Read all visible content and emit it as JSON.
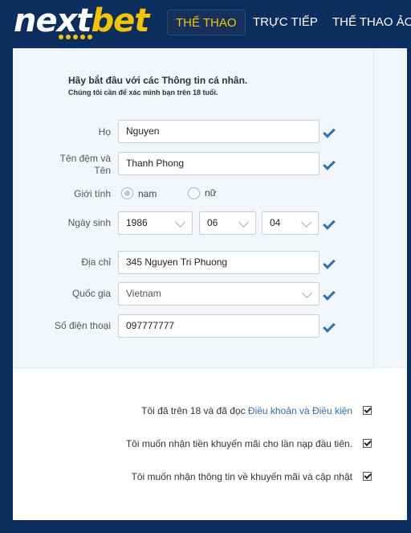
{
  "brand": {
    "name_part1": "next",
    "name_part2": "bet"
  },
  "nav": {
    "items": [
      {
        "label": "Thể thao",
        "active": true
      },
      {
        "label": "Trực tiếp",
        "active": false
      },
      {
        "label": "Thể thao ảo",
        "active": false
      }
    ]
  },
  "form": {
    "intro_title": "Hãy bắt đầu với các Thông tin cá nhân.",
    "intro_sub": "Chúng tôi cần để xác minh bạn trên 18 tuổi.",
    "last_name": {
      "label": "Họ",
      "value": "Nguyen"
    },
    "first_name": {
      "label_line1": "Tên đệm và",
      "label_line2": "Tên",
      "value": "Thanh Phong"
    },
    "gender": {
      "label": "Giới tính",
      "option_male": "nam",
      "option_female": "nữ",
      "selected": "nam"
    },
    "birthdate": {
      "label": "Ngày sinh",
      "year": "1986",
      "month": "06",
      "day": "04"
    },
    "address": {
      "label": "Địa chỉ",
      "value": "345 Nguyen Tri Phuong"
    },
    "country": {
      "label": "Quốc gia",
      "value": "Vietnam"
    },
    "phone": {
      "label": "Số điện thoại",
      "value": "097777777"
    }
  },
  "consents": {
    "terms_prefix": "Tôi đã trên 18 và đã đọc ",
    "terms_link": "Điều khoản và Điều kiện",
    "bonus": "Tôi muốn nhận tiền khuyến mãi cho lần nạp đầu tiên.",
    "newsletter": "Tôi muốn nhận thông tin về khuyến mãi và cập nhật"
  },
  "colors": {
    "navy": "#0b2e5e",
    "brand_yellow": "#f5c400",
    "check_blue": "#2d6fb5",
    "link_blue": "#2d6fb5"
  }
}
